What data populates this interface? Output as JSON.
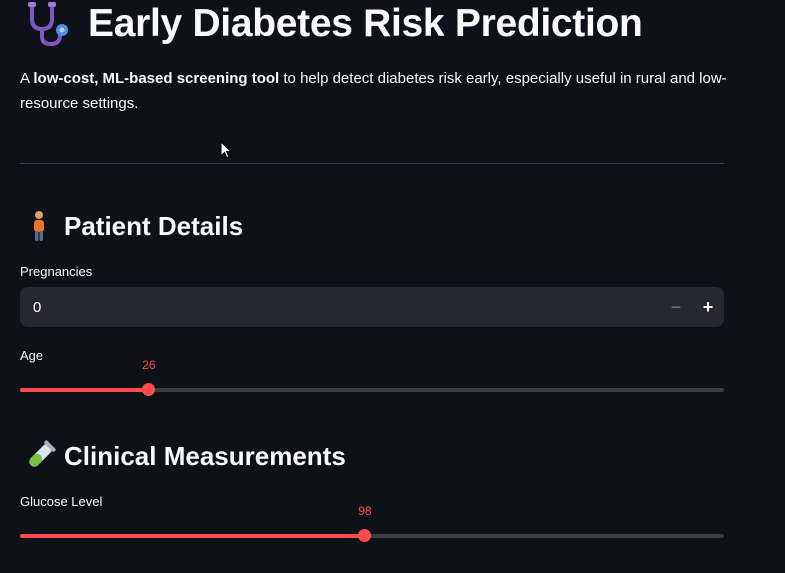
{
  "header": {
    "title": "Early Diabetes Risk Prediction",
    "icon": "stethoscope-icon"
  },
  "intro": {
    "prefix": "A ",
    "bold": "low-cost, ML-based screening tool",
    "suffix": " to help detect diabetes risk early, especially useful in rural and low-resource settings."
  },
  "patient_section": {
    "icon": "person-icon",
    "heading": "Patient Details",
    "pregnancies": {
      "label": "Pregnancies",
      "value": "0",
      "minus": "−",
      "plus": "+"
    },
    "age": {
      "label": "Age",
      "value": "26",
      "fraction": 0.183
    }
  },
  "clinical_section": {
    "icon": "test-tube-icon",
    "heading": "Clinical Measurements",
    "glucose": {
      "label": "Glucose Level",
      "value": "98",
      "fraction": 0.49
    }
  },
  "colors": {
    "background": "#0e1117",
    "accent": "#ff4b4b",
    "input_bg": "#262730"
  }
}
